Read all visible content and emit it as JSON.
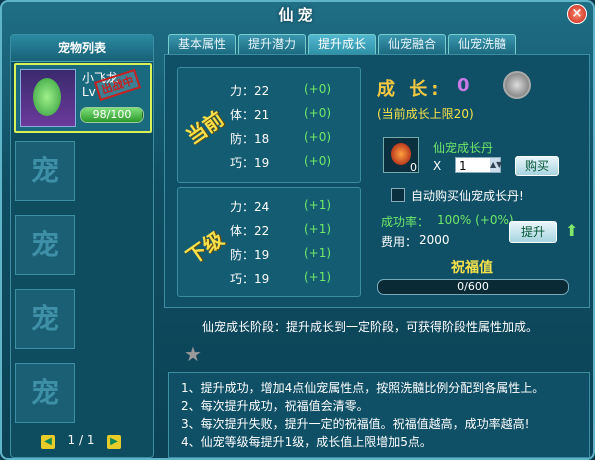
{
  "window": {
    "title": "仙宠",
    "close": "×"
  },
  "sidebar": {
    "header": "宠物列表",
    "pet": {
      "name": "小飞龙",
      "level": "Lv",
      "stamp": "出战中",
      "hp": "98/100",
      "hp_fraction": 0.98
    },
    "slot_glyph": "宠",
    "pager": {
      "prev": "◀",
      "page": "1 / 1",
      "next": "▶"
    }
  },
  "tabs": [
    {
      "label": "基本属性"
    },
    {
      "label": "提升潜力"
    },
    {
      "label": "提升成长"
    },
    {
      "label": "仙宠融合"
    },
    {
      "label": "仙宠洗髓"
    }
  ],
  "current": {
    "label": "当前",
    "stats": [
      {
        "name": "力：22",
        "delta": "(+0)"
      },
      {
        "name": "体：21",
        "delta": "(+0)"
      },
      {
        "name": "防：18",
        "delta": "(+0)"
      },
      {
        "name": "巧：19",
        "delta": "(+0)"
      }
    ]
  },
  "next": {
    "label": "下级",
    "stats": [
      {
        "name": "力：24",
        "delta": "(+1)"
      },
      {
        "name": "体：22",
        "delta": "(+1)"
      },
      {
        "name": "防：19",
        "delta": "(+1)"
      },
      {
        "name": "巧：19",
        "delta": "(+1)"
      }
    ]
  },
  "growth": {
    "label": "成 长:",
    "value": "0",
    "limit": "(当前成长上限20)",
    "item_name": "仙宠成长丹",
    "item_count": "0",
    "times": "X",
    "qty": "1",
    "buy": "购买",
    "auto_buy": "自动购买仙宠成长丹!",
    "success_label": "成功率：",
    "success_value": "100% (+0%)",
    "cost_label": "费用：",
    "cost_value": "2000",
    "upgrade": "提升"
  },
  "wish": {
    "title": "祝福值",
    "value": "0/600",
    "fraction": 0
  },
  "description": "仙宠成长阶段：提升成长到一定阶段，可获得阶段性属性加成。",
  "rules": [
    "1、提升成功，增加4点仙宠属性点，按照洗髓比例分配到各属性上。",
    "2、每次提升成功，祝福值会清零。",
    "3、每次提升失败，提升一定的祝福值。祝福值越高，成功率越高!",
    "4、仙宠等级每提升1级，成长值上限增加5点。"
  ]
}
